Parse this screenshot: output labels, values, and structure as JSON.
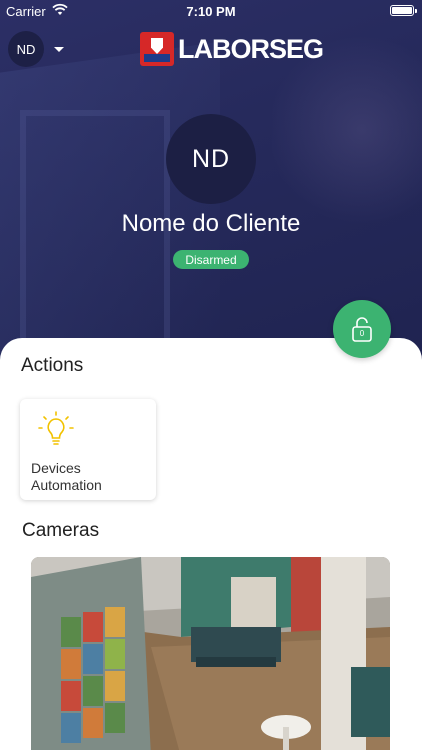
{
  "status_bar": {
    "carrier": "Carrier",
    "time": "7:10 PM"
  },
  "header": {
    "account_initials": "ND",
    "brand": "LABORSEG"
  },
  "client": {
    "initials": "ND",
    "name": "Nome do Cliente",
    "status": "Disarmed",
    "lock_badge": "0"
  },
  "actions": {
    "title": "Actions",
    "items": [
      {
        "line1": "Devices",
        "line2": "Automation",
        "icon": "lightbulb-icon"
      }
    ]
  },
  "cameras": {
    "title": "Cameras"
  },
  "colors": {
    "hero": "#262a5c",
    "accent_green": "#3cb371",
    "bulb_yellow": "#f2c200",
    "brand_red": "#d62828"
  }
}
